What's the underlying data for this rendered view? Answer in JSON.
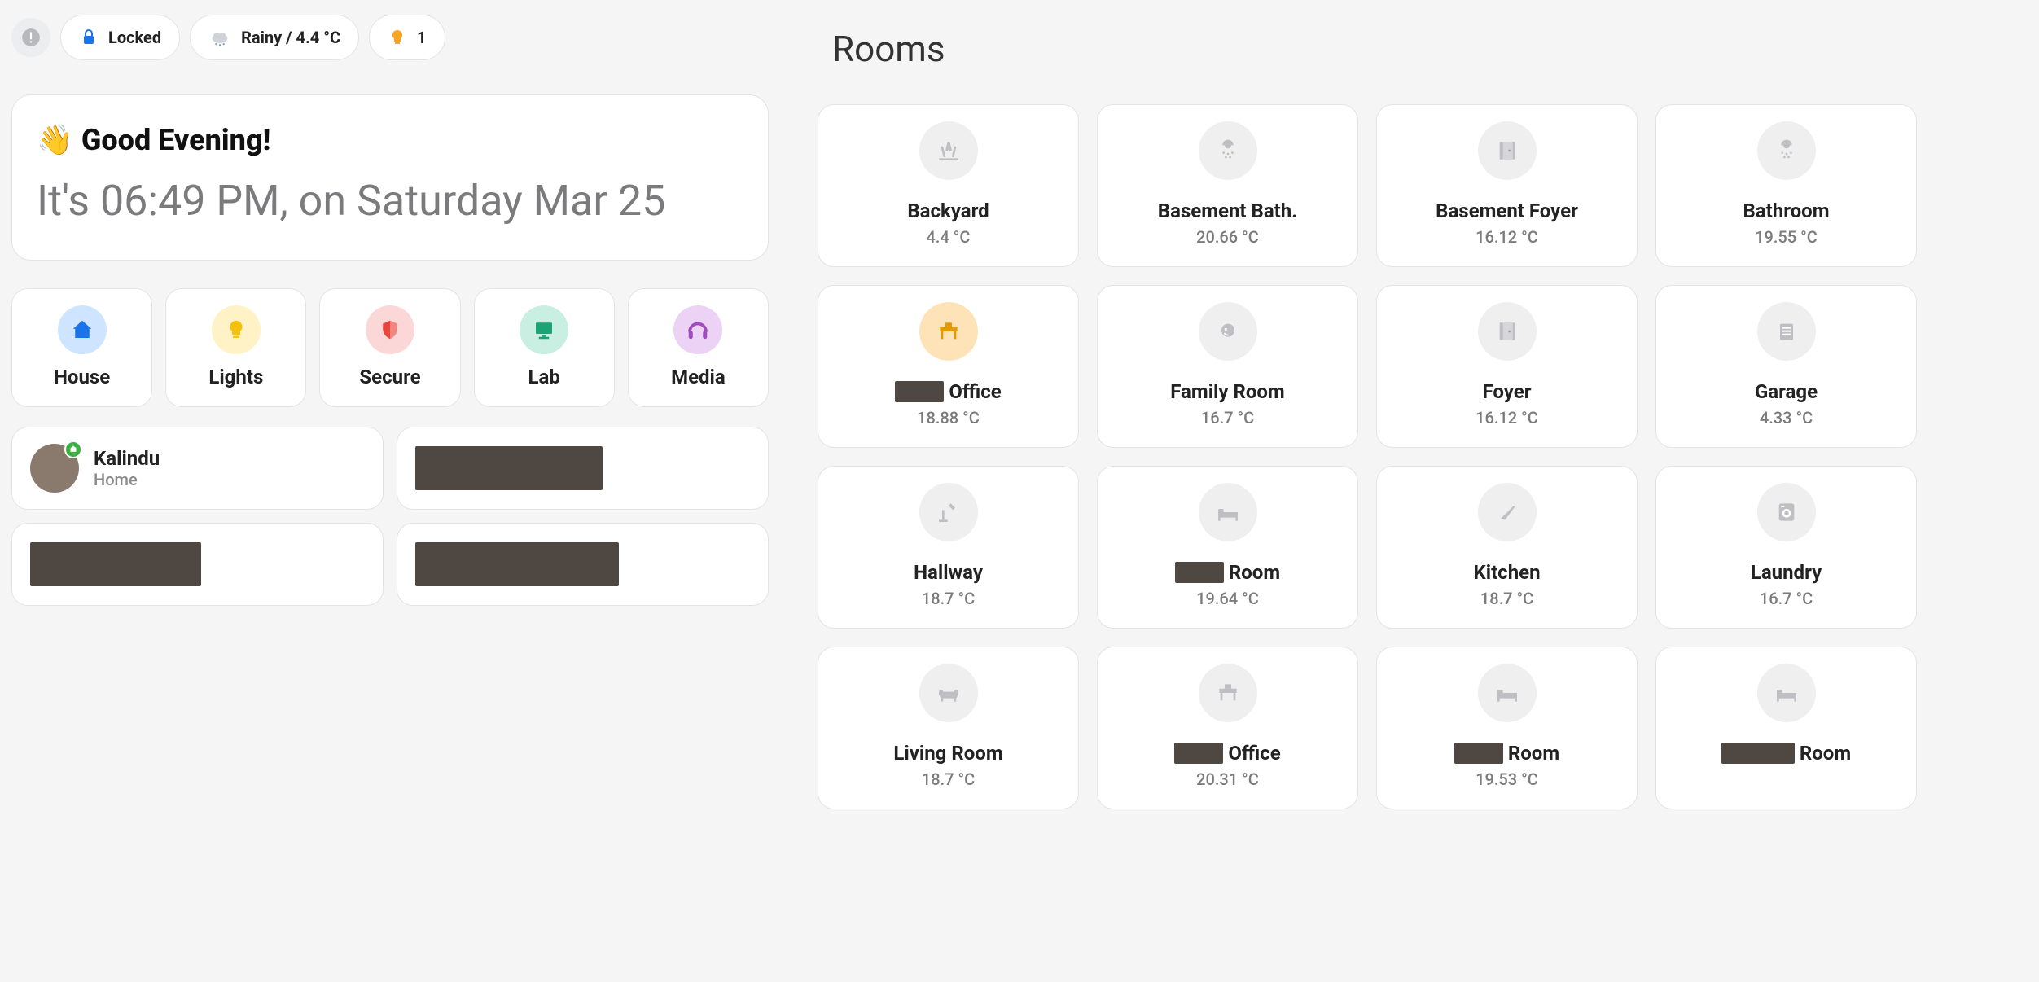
{
  "chips": {
    "locked_label": "Locked",
    "weather_label": "Rainy / 4.4 °C",
    "lights_on_count": "1"
  },
  "greeting": {
    "title": "Good Evening!",
    "time_line": "It's 06:49 PM, on Saturday Mar 25"
  },
  "nav": [
    {
      "label": "House",
      "icon": "house-icon",
      "bg": "#cfe4ff",
      "fg": "#1a73e8"
    },
    {
      "label": "Lights",
      "icon": "bulb-icon",
      "bg": "#fff2c6",
      "fg": "#f4c20d"
    },
    {
      "label": "Secure",
      "icon": "shield-icon",
      "bg": "#fcd7d7",
      "fg": "#e8453c"
    },
    {
      "label": "Lab",
      "icon": "monitor-icon",
      "bg": "#c9efe3",
      "fg": "#1aa374"
    },
    {
      "label": "Media",
      "icon": "headphones-icon",
      "bg": "#ecd2f5",
      "fg": "#a24bbf"
    }
  ],
  "persons": [
    {
      "name": "Kalindu",
      "state": "Home",
      "has_avatar": true
    },
    {
      "redacted": true
    },
    {
      "redacted": true
    },
    {
      "redacted": true
    }
  ],
  "rooms": {
    "heading": "Rooms",
    "items": [
      {
        "name": "Backyard",
        "temp": "4.4 °C",
        "icon": "grass-icon"
      },
      {
        "name": "Basement Bath.",
        "temp": "20.66 °C",
        "icon": "shower-icon"
      },
      {
        "name": "Basement Foyer",
        "temp": "16.12 °C",
        "icon": "door-icon"
      },
      {
        "name": "Bathroom",
        "temp": "19.55 °C",
        "icon": "shower-icon"
      },
      {
        "name": "Office",
        "temp": "18.88 °C",
        "icon": "desk-icon",
        "prefix_redacted": true,
        "active": true
      },
      {
        "name": "Family Room",
        "temp": "16.7 °C",
        "icon": "sofa-icon"
      },
      {
        "name": "Foyer",
        "temp": "16.12 °C",
        "icon": "door-icon"
      },
      {
        "name": "Garage",
        "temp": "4.33 °C",
        "icon": "garage-icon"
      },
      {
        "name": "Hallway",
        "temp": "18.7 °C",
        "icon": "lamp-icon"
      },
      {
        "name": "Room",
        "temp": "19.64 °C",
        "icon": "bed-icon",
        "prefix_redacted": true
      },
      {
        "name": "Kitchen",
        "temp": "18.7 °C",
        "icon": "knife-icon"
      },
      {
        "name": "Laundry",
        "temp": "16.7 °C",
        "icon": "washer-icon"
      },
      {
        "name": "Living Room",
        "temp": "18.7 °C",
        "icon": "couch-icon"
      },
      {
        "name": "Office",
        "temp": "20.31 °C",
        "icon": "desk-icon",
        "prefix_redacted": true
      },
      {
        "name": "Room",
        "temp": "19.53 °C",
        "icon": "bed-icon",
        "prefix_redacted": true
      },
      {
        "name": "Room",
        "temp": "",
        "icon": "bed-icon",
        "prefix_redacted": true,
        "prefix_wide": true
      }
    ]
  }
}
